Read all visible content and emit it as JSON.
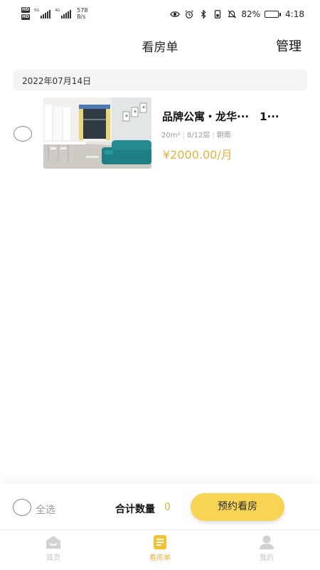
{
  "status_bar": {
    "network_left_top": "HD",
    "network_left_bottom": "HD",
    "signal1_label": "5G",
    "signal2_label": "4G",
    "speed_value": "578",
    "speed_unit": "B/s",
    "battery_percent": "82%",
    "battery_level": 0.82,
    "time": "4:18",
    "icons": [
      "eye-icon",
      "alarm-icon",
      "bluetooth-icon",
      "phone-battery-icon",
      "mute-icon",
      "battery-icon"
    ]
  },
  "header": {
    "title": "看房单",
    "manage_label": "管理"
  },
  "groups": [
    {
      "date": "2022年07月14日",
      "items": [
        {
          "title": "品牌公寓・龙华···　1···",
          "area": "20m²",
          "floor": "8/12层",
          "orientation": "朝南",
          "price": "¥2000.00/月",
          "checked": false
        }
      ]
    }
  ],
  "action_bar": {
    "select_all_label": "全选",
    "total_label": "合计数量",
    "total_count": "0",
    "book_button_label": "预约看房"
  },
  "tab_bar": {
    "tabs": [
      {
        "label": "首页",
        "icon": "home-icon",
        "active": false
      },
      {
        "label": "看房单",
        "icon": "list-icon",
        "active": true
      },
      {
        "label": "我的",
        "icon": "profile-icon",
        "active": false
      }
    ]
  },
  "colors": {
    "accent": "#e2b33f",
    "button_bg": "#f8d455",
    "date_bar_bg": "#f3f4f6",
    "inactive_tab": "#c4c4c4"
  }
}
